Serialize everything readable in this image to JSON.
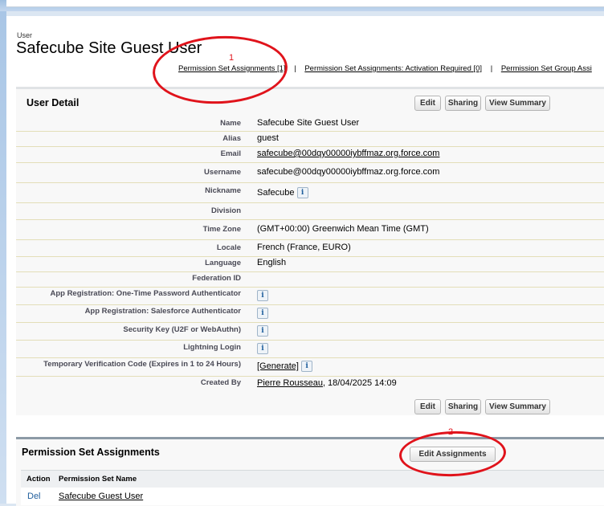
{
  "breadcrumb": "User",
  "page_title": "Safecube Site Guest User",
  "related_links": [
    {
      "label": "Permission Set Assignments",
      "count": "[1]"
    },
    {
      "label": "Permission Set Assignments: Activation Required",
      "count": "[0]"
    },
    {
      "label": "Permission Set Group Assi",
      "count": ""
    }
  ],
  "user_detail": {
    "title": "User Detail",
    "buttons": {
      "edit": "Edit",
      "sharing": "Sharing",
      "view_summary": "View Summary"
    },
    "fields": [
      {
        "label": "Name",
        "value": "Safecube Site Guest User"
      },
      {
        "label": "Alias",
        "value": "guest"
      },
      {
        "label": "Email",
        "value": "safecube@00dqy00000iybffmaz.org.force.com"
      },
      {
        "label": "Username",
        "value": "safecube@00dqy00000iybffmaz.org.force.com"
      },
      {
        "label": "Nickname",
        "value": "Safecube"
      },
      {
        "label": "Division",
        "value": ""
      },
      {
        "label": "Time Zone",
        "value": "(GMT+00:00) Greenwich Mean Time (GMT)"
      },
      {
        "label": "Locale",
        "value": "French (France, EURO)"
      },
      {
        "label": "Language",
        "value": "English"
      },
      {
        "label": "Federation ID",
        "value": ""
      },
      {
        "label": "App Registration: One-Time Password Authenticator",
        "value": ""
      },
      {
        "label": "App Registration: Salesforce Authenticator",
        "value": ""
      },
      {
        "label": "Security Key (U2F or WebAuthn)",
        "value": ""
      },
      {
        "label": "Lightning Login",
        "value": ""
      },
      {
        "label": "Temporary Verification Code (Expires in 1 to 24 Hours)",
        "value": "[Generate]"
      },
      {
        "label": "Created By",
        "value": "Pierre Rousseau",
        "extra": ", 18/04/2025 14:09"
      }
    ],
    "info_glyph": "i"
  },
  "permission_set_assignments": {
    "title": "Permission Set Assignments",
    "edit_button": "Edit Assignments",
    "columns": [
      "Action",
      "Permission Set Name"
    ],
    "rows": [
      {
        "action": "Del",
        "name": "Safecube Guest User"
      }
    ]
  },
  "annotations": {
    "one": "1",
    "two": "2",
    "color": "#e0131b"
  }
}
